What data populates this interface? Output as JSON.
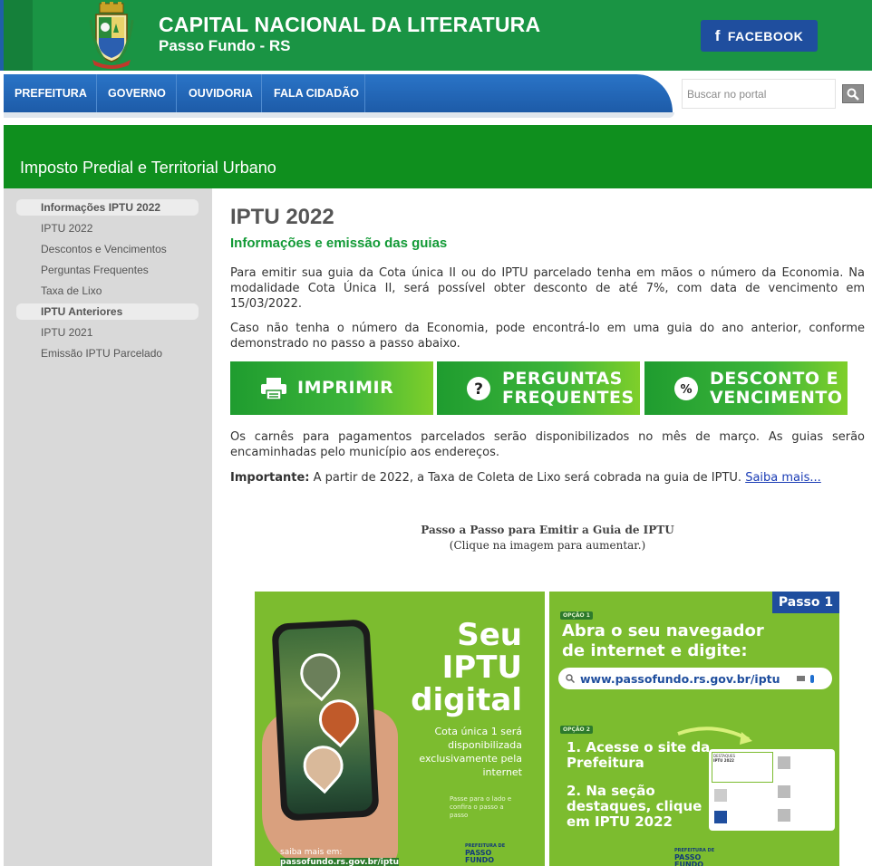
{
  "header": {
    "title": "CAPITAL NACIONAL DA LITERATURA",
    "subtitle": "Passo Fundo - RS",
    "facebook_label": "FACEBOOK",
    "colors": {
      "green": "#1a9444",
      "blue": "#1f4e9e"
    }
  },
  "nav": {
    "items": [
      "PREFEITURA",
      "GOVERNO",
      "OUVIDORIA",
      "FALA CIDADÃO"
    ],
    "search_placeholder": "Buscar no portal",
    "search_icon": "search-icon"
  },
  "section_title": "Imposto Predial e Territorial Urbano",
  "sidebar": {
    "groups": [
      {
        "label": "Informações IPTU 2022",
        "items": [
          "IPTU 2022",
          "Descontos e Vencimentos",
          "Perguntas Frequentes",
          "Taxa de Lixo"
        ]
      },
      {
        "label": "IPTU Anteriores",
        "items": [
          "IPTU 2021",
          "Emissão IPTU Parcelado"
        ]
      }
    ]
  },
  "main": {
    "title": "IPTU 2022",
    "subtitle": "Informações e emissão das guias",
    "para1": "Para emitir sua guia da Cota única II ou do IPTU parcelado tenha em mãos o número da Economia. Na modalidade Cota Única II, será possível obter desconto de até 7%, com data de vencimento em 15/03/2022.",
    "para2": "Caso não tenha o número da Economia, pode encontrá-lo em uma guia do ano anterior, conforme demonstrado no passo a passo abaixo.",
    "banners": [
      {
        "label": "IMPRIMIR",
        "icon": "printer-icon"
      },
      {
        "label_line1": "PERGUNTAS",
        "label_line2": "FREQUENTES",
        "icon": "question-icon"
      },
      {
        "label_line1": "DESCONTO E",
        "label_line2": "VENCIMENTO",
        "icon": "percent-icon"
      }
    ],
    "para3": "Os carnês para pagamentos parcelados serão disponibilizados no mês de março. As guias serão encaminhadas pelo município aos endereços.",
    "important_label": "Importante:",
    "important_text": " A partir de 2022, a Taxa de Coleta de Lixo será cobrada na guia de IPTU. ",
    "important_link": "Saiba mais...",
    "caption_title": "Passo a Passo para Emitir a Guia de IPTU",
    "caption_sub": "(Clique na imagem para aumentar.)"
  },
  "promo": {
    "headline": [
      "Seu",
      "IPTU",
      "digital"
    ],
    "note": "Cota única 1 será disponibilizada exclusivamente pela internet",
    "tap_note": "Passe para o lado e confira o passo a passo",
    "saiba_label": "saiba mais em:",
    "saiba_url": "passofundo.rs.gov.br/iptu",
    "logo_line1": "PREFEITURA DE",
    "logo_line2": "PASSO",
    "logo_line3": "FUNDO",
    "passo_tag": "Passo 1",
    "opcao1": "OPÇÃO 1",
    "opcao2": "OPÇÃO 2",
    "abra_line1": "Abra o seu navegador",
    "abra_line2": "de internet e digite:",
    "url": "www.passofundo.rs.gov.br/iptu",
    "step1_line1": "1. Acesse o site da",
    "step1_line2": "Prefeitura",
    "step2_line1": "2. Na seção",
    "step2_line2": "destaques, clique",
    "step2_line3": "em IPTU 2022",
    "mini_destaques": "DESTAQUES",
    "mini_iptu": "IPTU 2022"
  }
}
